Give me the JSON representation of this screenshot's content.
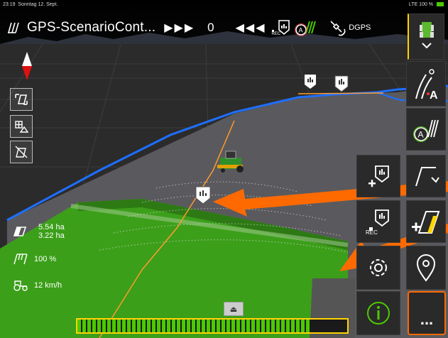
{
  "status": {
    "time": "23:19",
    "date": "Sonntag 12. Sept.",
    "signal": "LTE 100 %"
  },
  "header": {
    "title": "GPS-ScenarioCont...",
    "counter": "0",
    "gps_mode": "DGPS",
    "rec_label": "REC"
  },
  "stats": {
    "area_top": "5.54 ha",
    "area_bottom": "3.22 ha",
    "working_width": "100 %",
    "speed": "12 km/h"
  },
  "buttons": {
    "rec_label": "REC",
    "more_label": "..."
  },
  "progress": {
    "fill": 0.86
  },
  "colors": {
    "field_green": "#3c9f1a",
    "boundary_blue": "#1e6fff",
    "arrow_orange": "#ff6a00",
    "accent_yellow": "#ffd400"
  }
}
